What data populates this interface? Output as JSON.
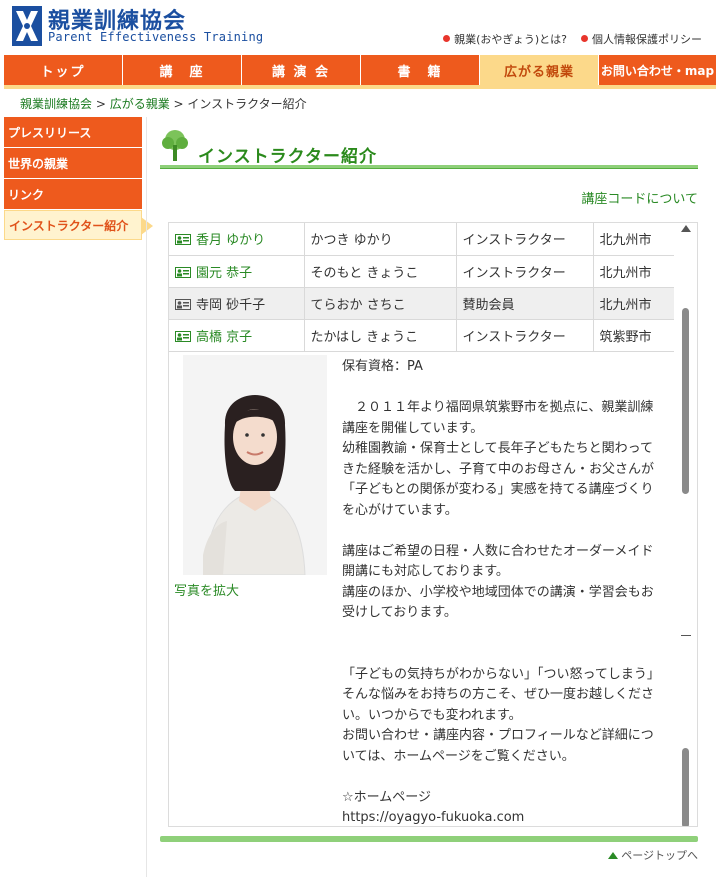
{
  "header": {
    "logo_jp": "親業訓練協会",
    "logo_en": "Parent Effectiveness Training",
    "links": [
      "親業(おやぎょう)とは?",
      "個人情報保護ポリシー"
    ]
  },
  "nav": [
    "トップ",
    "講　座",
    "講 演 会",
    "書　籍",
    "広がる親業",
    "お問い合わせ・map"
  ],
  "breadcrumb": {
    "home": "親業訓練協会",
    "sep1": " > ",
    "section": "広がる親業",
    "sep2": " > ",
    "current": "インストラクター紹介"
  },
  "sidebar": [
    "プレスリリース",
    "世界の親業",
    "リンク",
    "インストラクター紹介"
  ],
  "page_title": "インストラクター紹介",
  "code_link": "講座コードについて",
  "instructors": [
    {
      "name": "香月 ゆかり",
      "kana": "かつき ゆかり",
      "role": "インストラクター",
      "area": "北九州市"
    },
    {
      "name": "園元 恭子",
      "kana": "そのもと きょうこ",
      "role": "インストラクター",
      "area": "北九州市"
    },
    {
      "name": "寺岡 砂千子",
      "kana": "てらおか さちこ",
      "role": "賛助会員",
      "area": "北九州市"
    },
    {
      "name": "高橋 京子",
      "kana": "たかはし きょうこ",
      "role": "インストラクター",
      "area": "筑紫野市"
    }
  ],
  "detail": {
    "photo_link": "写真を拡大",
    "qualification": "保有資格：PA",
    "para1": "　２０１１年より福岡県筑紫野市を拠点に、親業訓練講座を開催しています。",
    "para2": "幼稚園教諭・保育士として長年子どもたちと関わってきた経験を活かし、子育て中のお母さん・お父さんが「子どもとの関係が変わる」実感を持てる講座づくりを心がけています。",
    "para3": "講座はご希望の日程・人数に合わせたオーダーメイド開講にも対応しております。",
    "para4": "講座のほか、小学校や地域団体での講演・学習会もお受けしております。",
    "para5": "「子どもの気持ちがわからない」「つい怒ってしまう」そんな悩みをお持ちの方こそ、ぜひ一度お越しください。いつからでも変われます。",
    "para6": "お問い合わせ・講座内容・プロフィールなど詳細については、ホームページをご覧ください。",
    "hp_label": "☆ホームページ",
    "hp_url": "https://oyagyo-fukuoka.com"
  },
  "page_top": "ページトップへ",
  "colors": {
    "nav": "#ee5a1d",
    "nav_active": "#fcd98a",
    "green": "#2a8a25",
    "brand_blue": "#1b4fa0"
  }
}
